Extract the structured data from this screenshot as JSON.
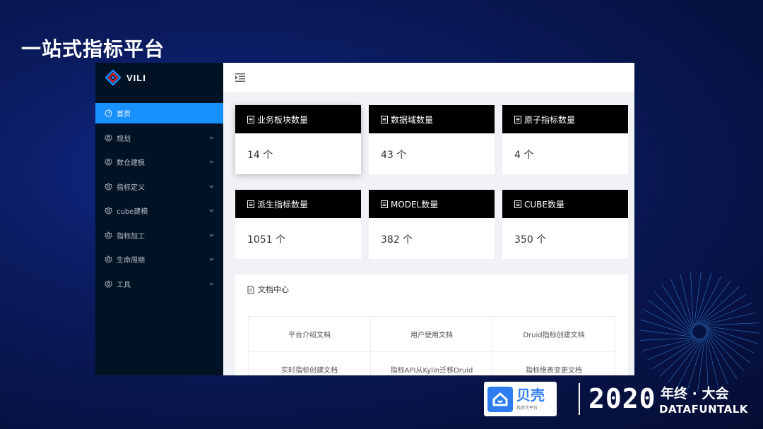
{
  "slide": {
    "title": "一站式指标平台"
  },
  "app": {
    "logo": {
      "text": "VILI",
      "icon": "vili-logo-icon"
    },
    "topbar": {
      "icon": "menu-fold-icon"
    },
    "sidebar": {
      "items": [
        {
          "label": "首页",
          "icon": "dashboard-icon",
          "active": true,
          "expandable": false
        },
        {
          "label": "规划",
          "icon": "settings-icon",
          "active": false,
          "expandable": true
        },
        {
          "label": "数仓建模",
          "icon": "settings-icon",
          "active": false,
          "expandable": true
        },
        {
          "label": "指标定义",
          "icon": "settings-icon",
          "active": false,
          "expandable": true
        },
        {
          "label": "cube建模",
          "icon": "settings-icon",
          "active": false,
          "expandable": true
        },
        {
          "label": "指标加工",
          "icon": "settings-icon",
          "active": false,
          "expandable": true
        },
        {
          "label": "生命周期",
          "icon": "settings-icon",
          "active": false,
          "expandable": true
        },
        {
          "label": "工具",
          "icon": "settings-icon",
          "active": false,
          "expandable": true
        }
      ]
    },
    "cards": [
      {
        "title": "业务板块数量",
        "value": "14 个"
      },
      {
        "title": "数据域数量",
        "value": "43 个"
      },
      {
        "title": "原子指标数量",
        "value": "4 个"
      },
      {
        "title": "派生指标数量",
        "value": "1051 个"
      },
      {
        "title": "MODEL数量",
        "value": "382 个"
      },
      {
        "title": "CUBE数量",
        "value": "350 个"
      }
    ],
    "docs": {
      "title": "文档中心",
      "items": [
        "平台介绍文档",
        "用户使用文档",
        "Druid指标创建文档",
        "实时指标创建文档",
        "指标API从Kylin迁移Druid",
        "指标维表变更文档"
      ]
    }
  },
  "branding": {
    "company": "贝壳",
    "company_sub": "找房大平台",
    "year": "2020",
    "event": "年终 · 大会",
    "event_en": "DATAFUNTALK"
  },
  "colors": {
    "accent": "#1890ff",
    "sidebar_bg": "#011224",
    "card_head_bg": "#000000",
    "brand_blue": "#2d7cf0"
  }
}
